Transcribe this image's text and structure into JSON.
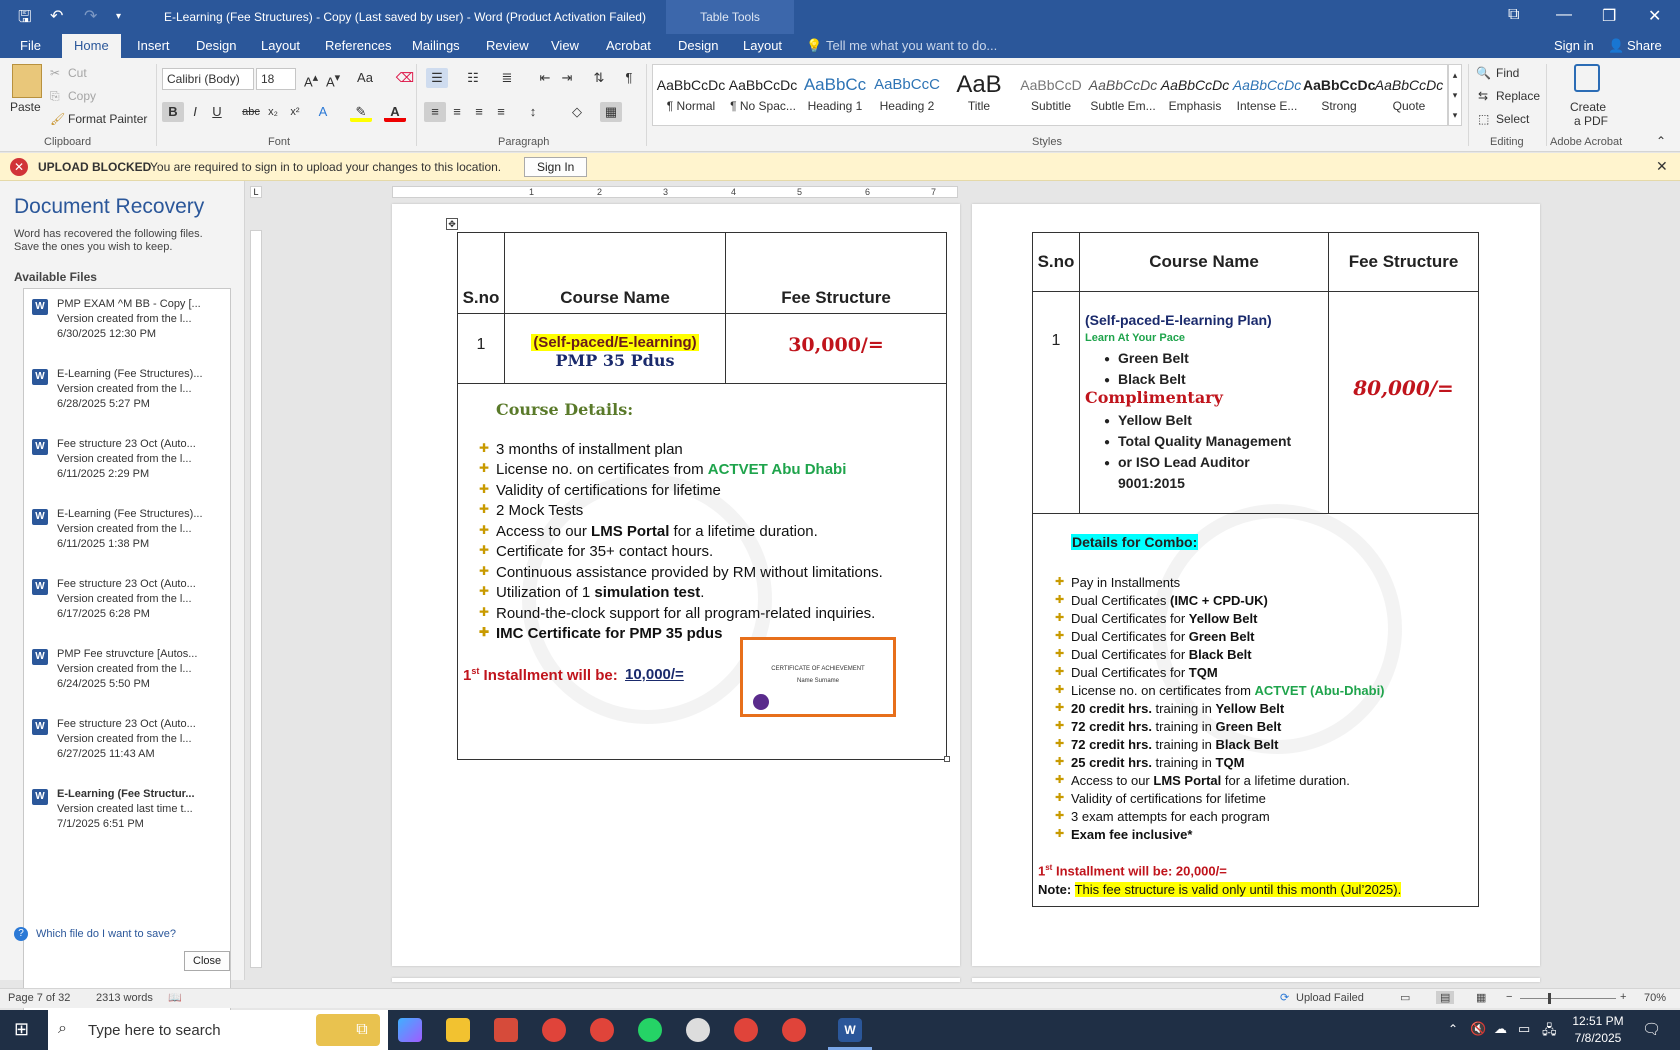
{
  "window": {
    "title": "E-Learning (Fee Structures) - Copy (Last saved by user) - Word (Product Activation Failed)",
    "context_tab": "Table Tools",
    "sign_in": "Sign in",
    "share": "Share"
  },
  "tabs": [
    "File",
    "Home",
    "Insert",
    "Design",
    "Layout",
    "References",
    "Mailings",
    "Review",
    "View",
    "Acrobat",
    "Design",
    "Layout"
  ],
  "tell_me": "Tell me what you want to do...",
  "ribbon": {
    "clipboard": {
      "paste": "Paste",
      "cut": "Cut",
      "copy": "Copy",
      "format_painter": "Format Painter",
      "label": "Clipboard"
    },
    "font": {
      "name": "Calibri (Body)",
      "size": "18",
      "label": "Font"
    },
    "paragraph": {
      "label": "Paragraph"
    },
    "styles": {
      "label": "Styles",
      "items": [
        {
          "sample": "AaBbCcDc",
          "name": "¶ Normal"
        },
        {
          "sample": "AaBbCcDc",
          "name": "¶ No Spac..."
        },
        {
          "sample": "AaBbCc",
          "name": "Heading 1"
        },
        {
          "sample": "AaBbCcC",
          "name": "Heading 2"
        },
        {
          "sample": "AaB",
          "name": "Title"
        },
        {
          "sample": "AaBbCcD",
          "name": "Subtitle"
        },
        {
          "sample": "AaBbCcDc",
          "name": "Subtle Em..."
        },
        {
          "sample": "AaBbCcDc",
          "name": "Emphasis"
        },
        {
          "sample": "AaBbCcDc",
          "name": "Intense E..."
        },
        {
          "sample": "AaBbCcDc",
          "name": "Strong"
        },
        {
          "sample": "AaBbCcDc",
          "name": "Quote"
        }
      ]
    },
    "editing": {
      "find": "Find",
      "replace": "Replace",
      "select": "Select",
      "label": "Editing"
    },
    "acrobat": {
      "create": "Create",
      "pdf": "a PDF",
      "label": "Adobe Acrobat"
    }
  },
  "message_bar": {
    "title": "UPLOAD BLOCKED",
    "text": "You are required to sign in to upload your changes to this location.",
    "button": "Sign In"
  },
  "recovery": {
    "title": "Document Recovery",
    "desc1": "Word has recovered the following files.",
    "desc2": "Save the ones you wish to keep.",
    "available": "Available Files",
    "files": [
      {
        "name": "PMP EXAM ^M BB - Copy  [...",
        "version": "Version created from the l...",
        "date": "6/30/2025 12:30 PM"
      },
      {
        "name": "E-Learning (Fee Structures)...",
        "version": "Version created from the l...",
        "date": "6/28/2025 5:27 PM"
      },
      {
        "name": "Fee structure 23 Oct (Auto...",
        "version": "Version created from the l...",
        "date": "6/11/2025 2:29 PM"
      },
      {
        "name": "E-Learning (Fee Structures)...",
        "version": "Version created from the l...",
        "date": "6/11/2025 1:38 PM"
      },
      {
        "name": "Fee structure 23 Oct (Auto...",
        "version": "Version created from the l...",
        "date": "6/17/2025 6:28 PM"
      },
      {
        "name": "PMP Fee struvcture  [Autos...",
        "version": "Version created from the l...",
        "date": "6/24/2025 5:50 PM"
      },
      {
        "name": "Fee structure 23 Oct (Auto...",
        "version": "Version created from the l...",
        "date": "6/27/2025 11:43 AM"
      },
      {
        "name": "E-Learning (Fee Structur...",
        "version": "Version created last time t...",
        "date": "7/1/2025 6:51 PM"
      }
    ],
    "help": "Which file do I want to save?",
    "close": "Close"
  },
  "page_left": {
    "h_sno": "S.no",
    "h_course": "Course Name",
    "h_fee": "Fee Structure",
    "sno": "1",
    "course_line1": "(Self-paced/E-learning)",
    "course_line2": "PMP 35 Pdus",
    "fee": "30,000/=",
    "details_title": "Course Details:",
    "bullets": [
      "3 months of installment plan",
      "License no. on certificates from ",
      "Validity of certifications for lifetime",
      " 2 Mock Tests",
      "Access to our ",
      "Certificate for 35+ contact hours.",
      "Continuous assistance provided by RM without limitations.",
      "Utilization of 1 ",
      "Round-the-clock support for all program-related inquiries.",
      "IMC Certificate for PMP 35 pdus"
    ],
    "actvet": "ACTVET Abu Dhabi",
    "lms": "LMS Portal",
    "lms_tail": " for a lifetime duration.",
    "sim": "simulation test",
    "sim_tail": ".",
    "installment_label_sup": "st",
    "installment_label_num": "1",
    "installment_label": " Installment will be:",
    "installment_value": "10,000/=",
    "cert": {
      "title": "CERTIFICATE OF ACHIEVEMENT",
      "name": "Name Surname"
    }
  },
  "page_right": {
    "h_sno": "S.no",
    "h_course": "Course Name",
    "h_fee": "Fee Structure",
    "sno": "1",
    "plan": "(Self-paced-E-learning Plan)",
    "pace": "Learn At Your Pace",
    "belts1": [
      "Green Belt",
      "Black Belt"
    ],
    "complimentary": "Complimentary",
    "belts2": [
      "Yellow Belt",
      "Total Quality Management",
      "or ISO Lead Auditor",
      "9001:2015"
    ],
    "fee": "80,000/=",
    "combo_title": "Details for Combo:",
    "bullets": [
      {
        "pre": "Pay in Installments",
        "bold": "",
        "post": ""
      },
      {
        "pre": "Dual Certificates ",
        "bold": "(IMC + CPD-UK)",
        "post": ""
      },
      {
        "pre": "Dual Certificates for ",
        "bold": "Yellow Belt",
        "post": ""
      },
      {
        "pre": "Dual Certificates for ",
        "bold": "Green Belt",
        "post": ""
      },
      {
        "pre": "Dual Certificates for ",
        "bold": "Black Belt",
        "post": ""
      },
      {
        "pre": "Dual Certificates for ",
        "bold": "TQM",
        "post": ""
      },
      {
        "pre": "License no. on certificates from ",
        "green": "ACTVET (Abu-Dhabi)",
        "post": ""
      },
      {
        "bold": "20 credit hrs.",
        "pre": " training in ",
        "bold2": "Yellow Belt"
      },
      {
        "bold": "72 credit hrs.",
        "pre": " training in ",
        "bold2": "Green Belt"
      },
      {
        "bold": "72 credit hrs.",
        "pre": " training in ",
        "bold2": "Black Belt"
      },
      {
        "bold": "25 credit hrs.",
        "pre": " training in ",
        "bold2": "TQM"
      },
      {
        "pre": "Access to our ",
        "bold": "LMS Portal",
        "post": " for a lifetime duration."
      },
      {
        "pre": "Validity of certifications for lifetime",
        "bold": "",
        "post": ""
      },
      {
        "pre": "3 exam attempts for each program",
        "bold": "",
        "post": ""
      },
      {
        "pre": "",
        "bold": "Exam fee inclusive*",
        "post": ""
      }
    ],
    "installment_num": "1",
    "installment_sup": "st",
    "installment": " Installment will be: 20,000/=",
    "note_label": "Note:",
    "note": "This fee structure is valid only until this month (Jul’2025)."
  },
  "status": {
    "page": "Page 7 of 32",
    "words": "2313 words",
    "upload": "Upload Failed",
    "zoom": "70%"
  },
  "taskbar": {
    "search": "Type here to search",
    "time": "12:51 PM",
    "date": "7/8/2025"
  },
  "colors": {
    "word_blue": "#2b579a",
    "fee_red": "#c0141c",
    "highlight_yellow": "#ffff00",
    "combo_cyan": "#00ffff",
    "green": "#1fa44c",
    "course_details": "#5a7a2a"
  }
}
